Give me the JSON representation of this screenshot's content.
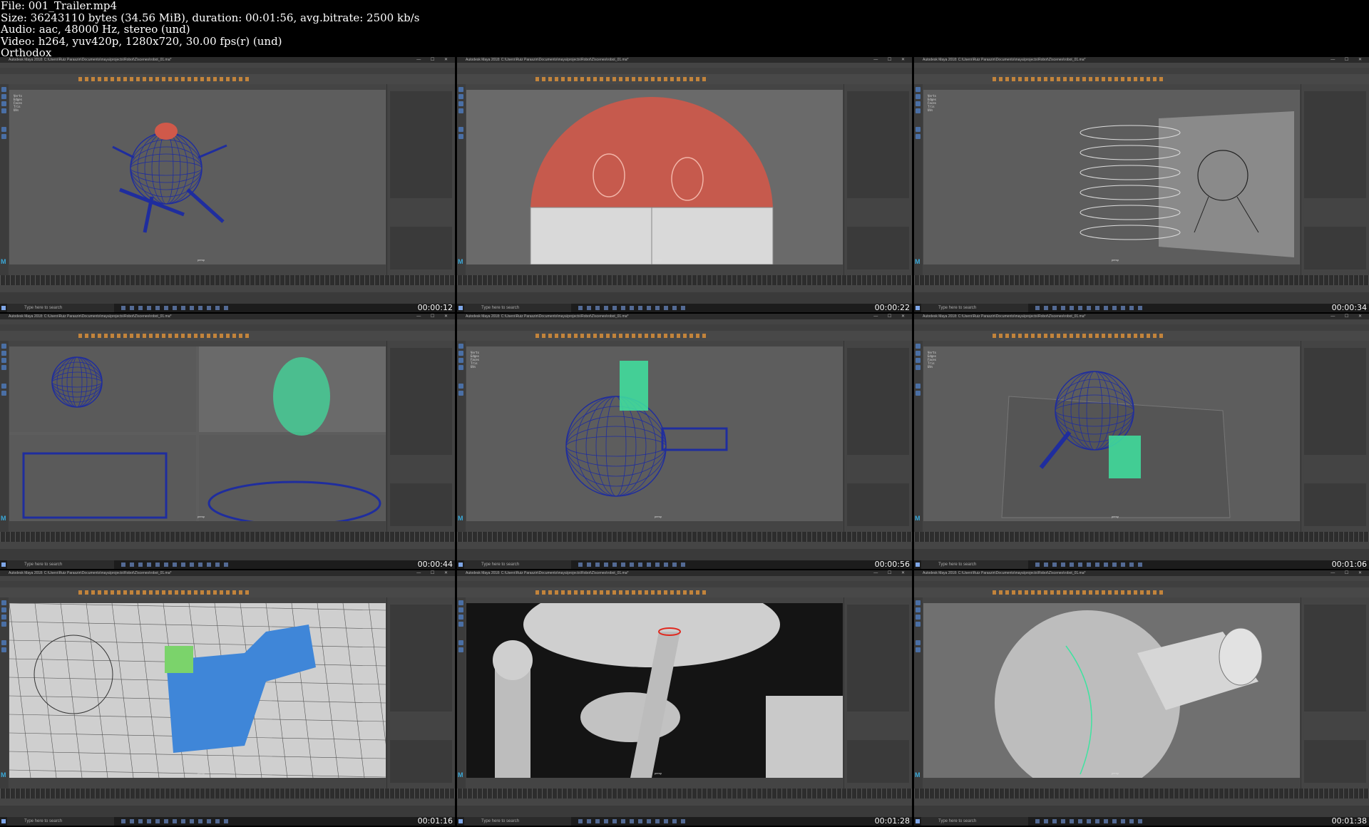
{
  "file_info": {
    "file": "File: 001_Trailer.mp4",
    "size": "Size: 36243110 bytes (34.56 MiB), duration: 00:01:56, avg.bitrate: 2500 kb/s",
    "audio": "Audio: aac, 48000 Hz, stereo (und)",
    "video": "Video: h264, yuv420p, 1280x720, 30.00 fps(r) (und)",
    "watermark": "Orthodox"
  },
  "app": {
    "window_title": "Autodesk Maya 2018: C:\\Users\\Ruiz Paraszin\\Documents\\maya\\projects\\Robot\\Z\\scenes\\robot_01.ma*",
    "search_placeholder": "Type here to search",
    "viewport_label": "persp",
    "logo": "M"
  },
  "tiles": [
    {
      "timestamp": "00:00:12",
      "scene": "robot-wireframe"
    },
    {
      "timestamp": "00:00:22",
      "scene": "dome-closeup"
    },
    {
      "timestamp": "00:00:34",
      "scene": "reference-plane"
    },
    {
      "timestamp": "00:00:44",
      "scene": "quad-view"
    },
    {
      "timestamp": "00:00:56",
      "scene": "top-wireframe"
    },
    {
      "timestamp": "00:01:06",
      "scene": "leg-selection"
    },
    {
      "timestamp": "00:01:16",
      "scene": "face-selection"
    },
    {
      "timestamp": "00:01:28",
      "scene": "pipe-closeup"
    },
    {
      "timestamp": "00:01:38",
      "scene": "cannon-closeup"
    }
  ],
  "colors": {
    "maya_bg": "#444444",
    "viewport_bg": "#5d5d5d",
    "wire_blue": "#1f2d9e",
    "select_green": "#3fe3a0",
    "dome_red": "#d0594a",
    "face_blue": "#3f86d8"
  }
}
